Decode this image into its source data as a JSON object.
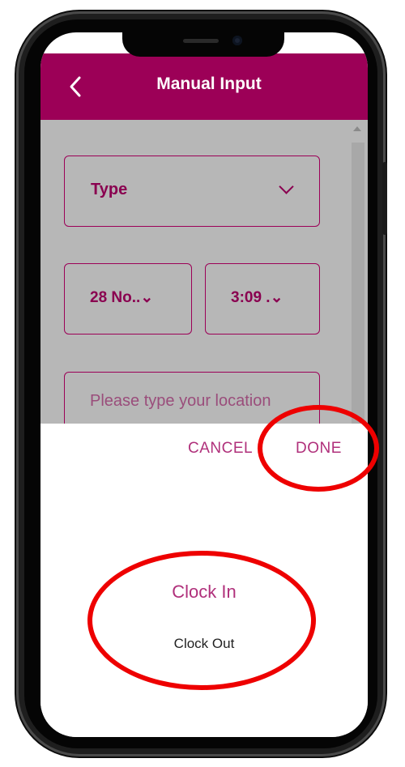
{
  "header": {
    "title": "Manual Input"
  },
  "form": {
    "type_label": "Type",
    "date_value": "28 No..",
    "time_value": "3:09 .",
    "location_placeholder": "Please type your location"
  },
  "sheet": {
    "cancel_label": "CANCEL",
    "done_label": "DONE",
    "options": [
      "Clock In",
      "Clock Out"
    ]
  },
  "colors": {
    "brand": "#9c0057",
    "accent_text": "#b0307b",
    "overlay": "#b7b7b7",
    "annotation": "#ee0000"
  },
  "icons": {
    "back": "chevron-left-icon",
    "dropdown": "chevron-down-icon"
  }
}
